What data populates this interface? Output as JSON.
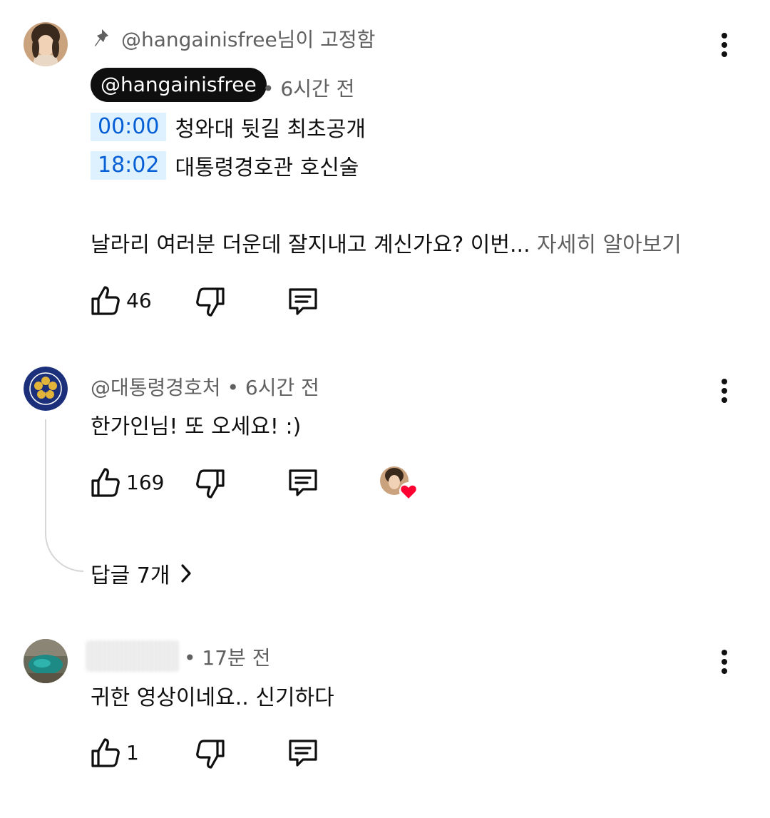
{
  "comments": [
    {
      "pinned_by": "@hangainisfree님이 고정함",
      "author": "@hangainisfree",
      "time": "• 6시간 전",
      "timestamps": [
        {
          "time": "00:00",
          "text": "청와대 뒷길 최초공개"
        },
        {
          "time": "18:02",
          "text": "대통령경호관 호신술"
        }
      ],
      "body": "날라리 여러분 더운데 잘지내고 계신가요? 이번...",
      "more_label": "자세히 알아보기",
      "likes": "46"
    },
    {
      "author": "@대통령경호처",
      "time": "• 6시간 전",
      "body": "한가인님! 또 오세요! :)",
      "likes": "169",
      "replies_label": "답글 7개",
      "creator_heart": true
    },
    {
      "author_hidden": true,
      "time": "• 17분 전",
      "body": "귀한 영상이네요..  신기하다",
      "likes": "1"
    }
  ],
  "icons": {
    "pin": "pin-icon",
    "like": "thumbs-up-icon",
    "dislike": "thumbs-down-icon",
    "reply": "comment-icon",
    "more": "kebab-menu-icon",
    "heart": "heart-icon",
    "chevron": "chevron-right-icon"
  },
  "colors": {
    "timestamp_bg": "#def1ff",
    "timestamp_text": "#065fd4",
    "heart": "#ff0033",
    "secondary_text": "#606060"
  }
}
